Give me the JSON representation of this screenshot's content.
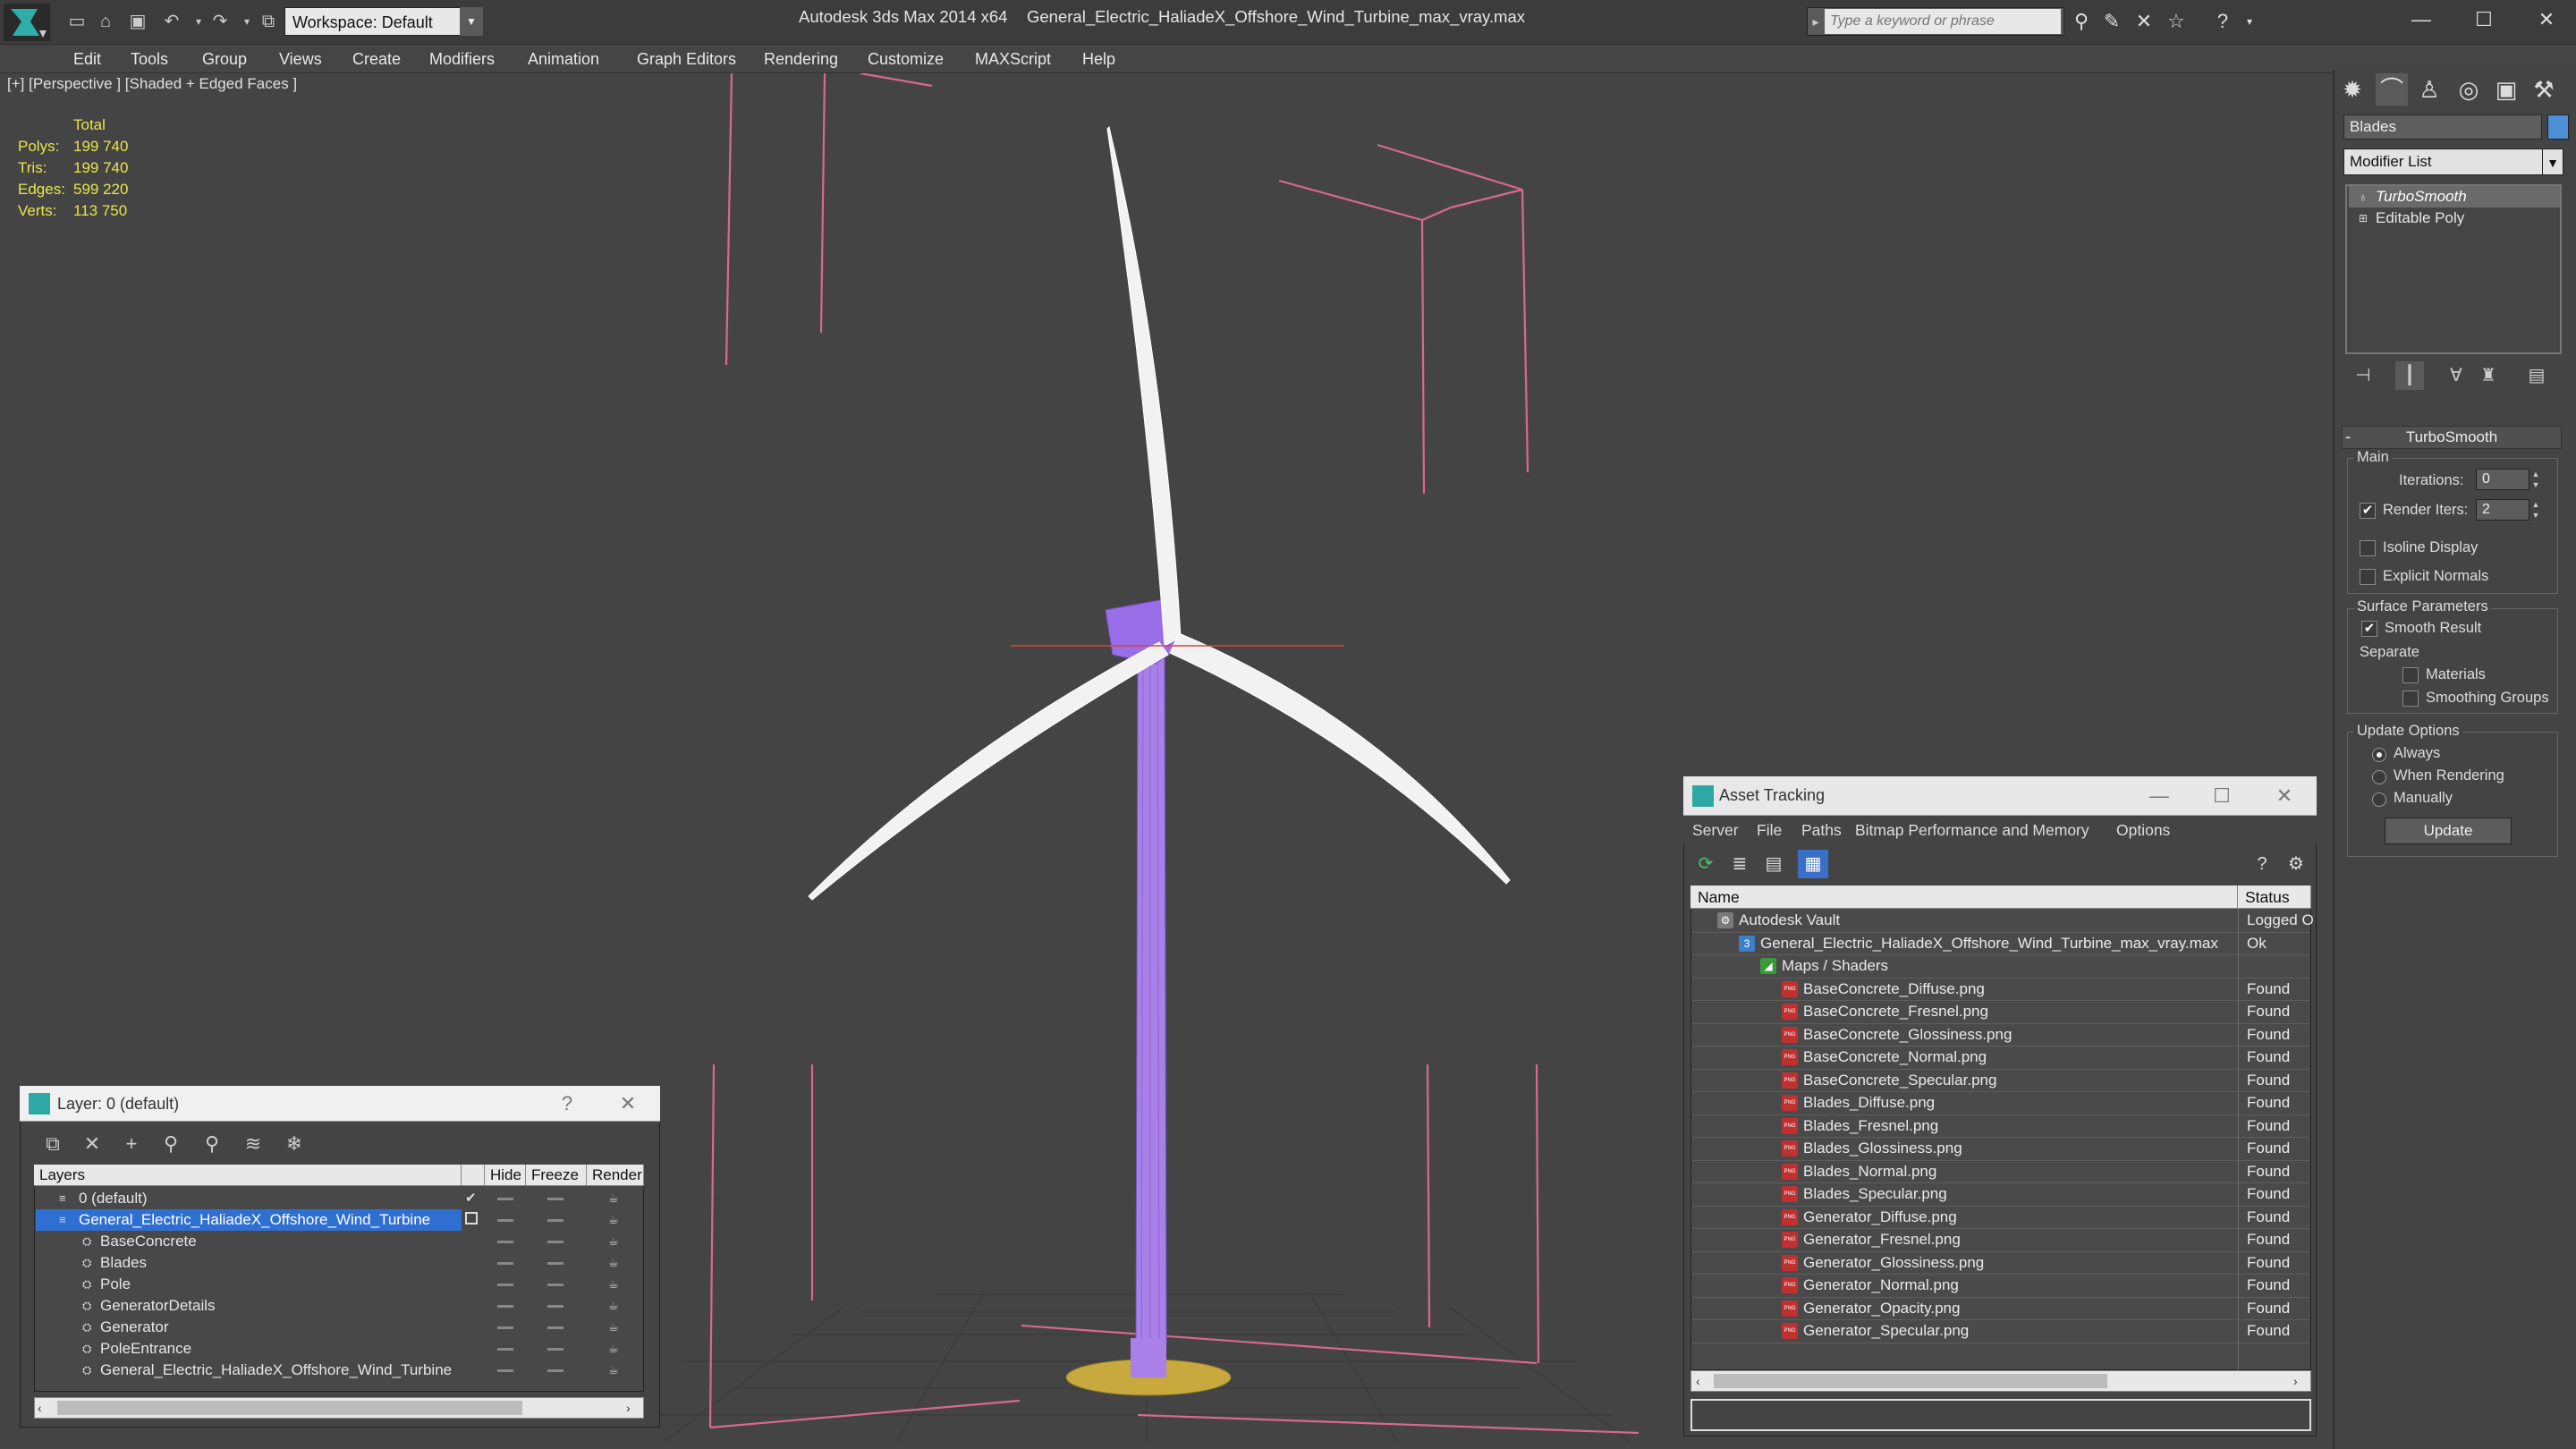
{
  "app": {
    "title": "Autodesk 3ds Max  2014 x64",
    "file": "General_Electric_HaliadeX_Offshore_Wind_Turbine_max_vray.max",
    "workspace": "Workspace: Default",
    "search_placeholder": "Type a keyword or phrase"
  },
  "menu": [
    "Edit",
    "Tools",
    "Group",
    "Views",
    "Create",
    "Modifiers",
    "Animation",
    "Graph Editors",
    "Rendering",
    "Customize",
    "MAXScript",
    "Help"
  ],
  "viewport": {
    "label": "[+] [Perspective ] [Shaded + Edged Faces ]",
    "stats": {
      "header": "Total",
      "rows": [
        {
          "label": "Polys:",
          "value": "199 740"
        },
        {
          "label": "Tris:",
          "value": "199 740"
        },
        {
          "label": "Edges:",
          "value": "599 220"
        },
        {
          "label": "Verts:",
          "value": "113 750"
        }
      ]
    }
  },
  "command_panel": {
    "object_name": "Blades",
    "object_color": "#4d8fd6",
    "modifier_list": "Modifier List",
    "stack": [
      "TurboSmooth",
      "Editable Poly"
    ],
    "rollout": "TurboSmooth",
    "main_label": "Main",
    "iterations_label": "Iterations:",
    "iterations_value": "0",
    "render_iters_label": "Render Iters:",
    "render_iters_value": "2",
    "isoline_label": "Isoline Display",
    "explicit_normals_label": "Explicit Normals",
    "surface_params_label": "Surface Parameters",
    "smooth_result_label": "Smooth Result",
    "separate_label": "Separate",
    "materials_label": "Materials",
    "smoothing_groups_label": "Smoothing Groups",
    "update_options_label": "Update Options",
    "always_label": "Always",
    "when_rendering_label": "When Rendering",
    "manually_label": "Manually",
    "update_button": "Update"
  },
  "layer_panel": {
    "title": "Layer: 0 (default)",
    "help": "?",
    "columns": [
      "Layers",
      "Hide",
      "Freeze",
      "Render"
    ],
    "rows": [
      {
        "name": "0 (default)",
        "indent": 0
      },
      {
        "name": "General_Electric_HaliadeX_Offshore_Wind_Turbine",
        "indent": 0
      },
      {
        "name": "BaseConcrete",
        "indent": 1
      },
      {
        "name": "Blades",
        "indent": 1
      },
      {
        "name": "Pole",
        "indent": 1
      },
      {
        "name": "GeneratorDetails",
        "indent": 1
      },
      {
        "name": "Generator",
        "indent": 1
      },
      {
        "name": "PoleEntrance",
        "indent": 1
      },
      {
        "name": "General_Electric_HaliadeX_Offshore_Wind_Turbine",
        "indent": 1
      }
    ]
  },
  "asset_tracking": {
    "title": "Asset Tracking",
    "menu": [
      "Server",
      "File",
      "Paths",
      "Bitmap Performance and Memory",
      "Options"
    ],
    "columns": [
      "Name",
      "Status"
    ],
    "rows": [
      {
        "name": "Autodesk Vault",
        "status": "Logged O",
        "level": 0,
        "icon": "vault"
      },
      {
        "name": "General_Electric_HaliadeX_Offshore_Wind_Turbine_max_vray.max",
        "status": "Ok",
        "level": 1,
        "icon": "max"
      },
      {
        "name": "Maps / Shaders",
        "status": "",
        "level": 2,
        "icon": "maps"
      },
      {
        "name": "BaseConcrete_Diffuse.png",
        "status": "Found",
        "level": 3,
        "icon": "png"
      },
      {
        "name": "BaseConcrete_Fresnel.png",
        "status": "Found",
        "level": 3,
        "icon": "png"
      },
      {
        "name": "BaseConcrete_Glossiness.png",
        "status": "Found",
        "level": 3,
        "icon": "png"
      },
      {
        "name": "BaseConcrete_Normal.png",
        "status": "Found",
        "level": 3,
        "icon": "png"
      },
      {
        "name": "BaseConcrete_Specular.png",
        "status": "Found",
        "level": 3,
        "icon": "png"
      },
      {
        "name": "Blades_Diffuse.png",
        "status": "Found",
        "level": 3,
        "icon": "png"
      },
      {
        "name": "Blades_Fresnel.png",
        "status": "Found",
        "level": 3,
        "icon": "png"
      },
      {
        "name": "Blades_Glossiness.png",
        "status": "Found",
        "level": 3,
        "icon": "png"
      },
      {
        "name": "Blades_Normal.png",
        "status": "Found",
        "level": 3,
        "icon": "png"
      },
      {
        "name": "Blades_Specular.png",
        "status": "Found",
        "level": 3,
        "icon": "png"
      },
      {
        "name": "Generator_Diffuse.png",
        "status": "Found",
        "level": 3,
        "icon": "png"
      },
      {
        "name": "Generator_Fresnel.png",
        "status": "Found",
        "level": 3,
        "icon": "png"
      },
      {
        "name": "Generator_Glossiness.png",
        "status": "Found",
        "level": 3,
        "icon": "png"
      },
      {
        "name": "Generator_Normal.png",
        "status": "Found",
        "level": 3,
        "icon": "png"
      },
      {
        "name": "Generator_Opacity.png",
        "status": "Found",
        "level": 3,
        "icon": "png"
      },
      {
        "name": "Generator_Specular.png",
        "status": "Found",
        "level": 3,
        "icon": "png"
      }
    ]
  }
}
